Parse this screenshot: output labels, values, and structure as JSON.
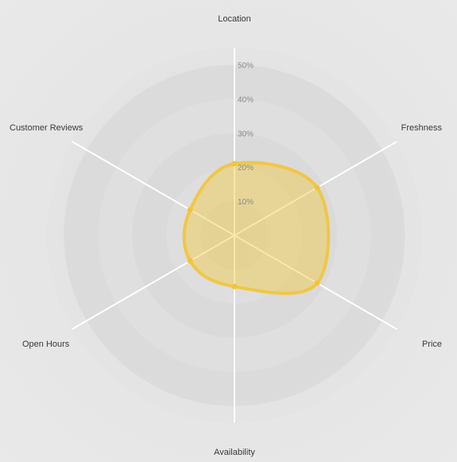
{
  "chart_data": {
    "type": "radar",
    "title": "",
    "axes": [
      "Location",
      "Freshness",
      "Price",
      "Availability",
      "Open Hours",
      "Customer Reviews"
    ],
    "tick_labels": [
      "10%",
      "20%",
      "30%",
      "40%",
      "50%"
    ],
    "ticks": [
      10,
      20,
      30,
      40,
      50
    ],
    "range": [
      0,
      55
    ],
    "grid": true,
    "series": [
      {
        "values": [
          21,
          28,
          28,
          15,
          15,
          15
        ]
      }
    ],
    "colors": {
      "fill": "#f0c940",
      "stroke": "#f2c43a",
      "axis": "#ffffff",
      "ring_dark": "#d6d6d6",
      "ring_light": "#e2e2e2"
    }
  }
}
